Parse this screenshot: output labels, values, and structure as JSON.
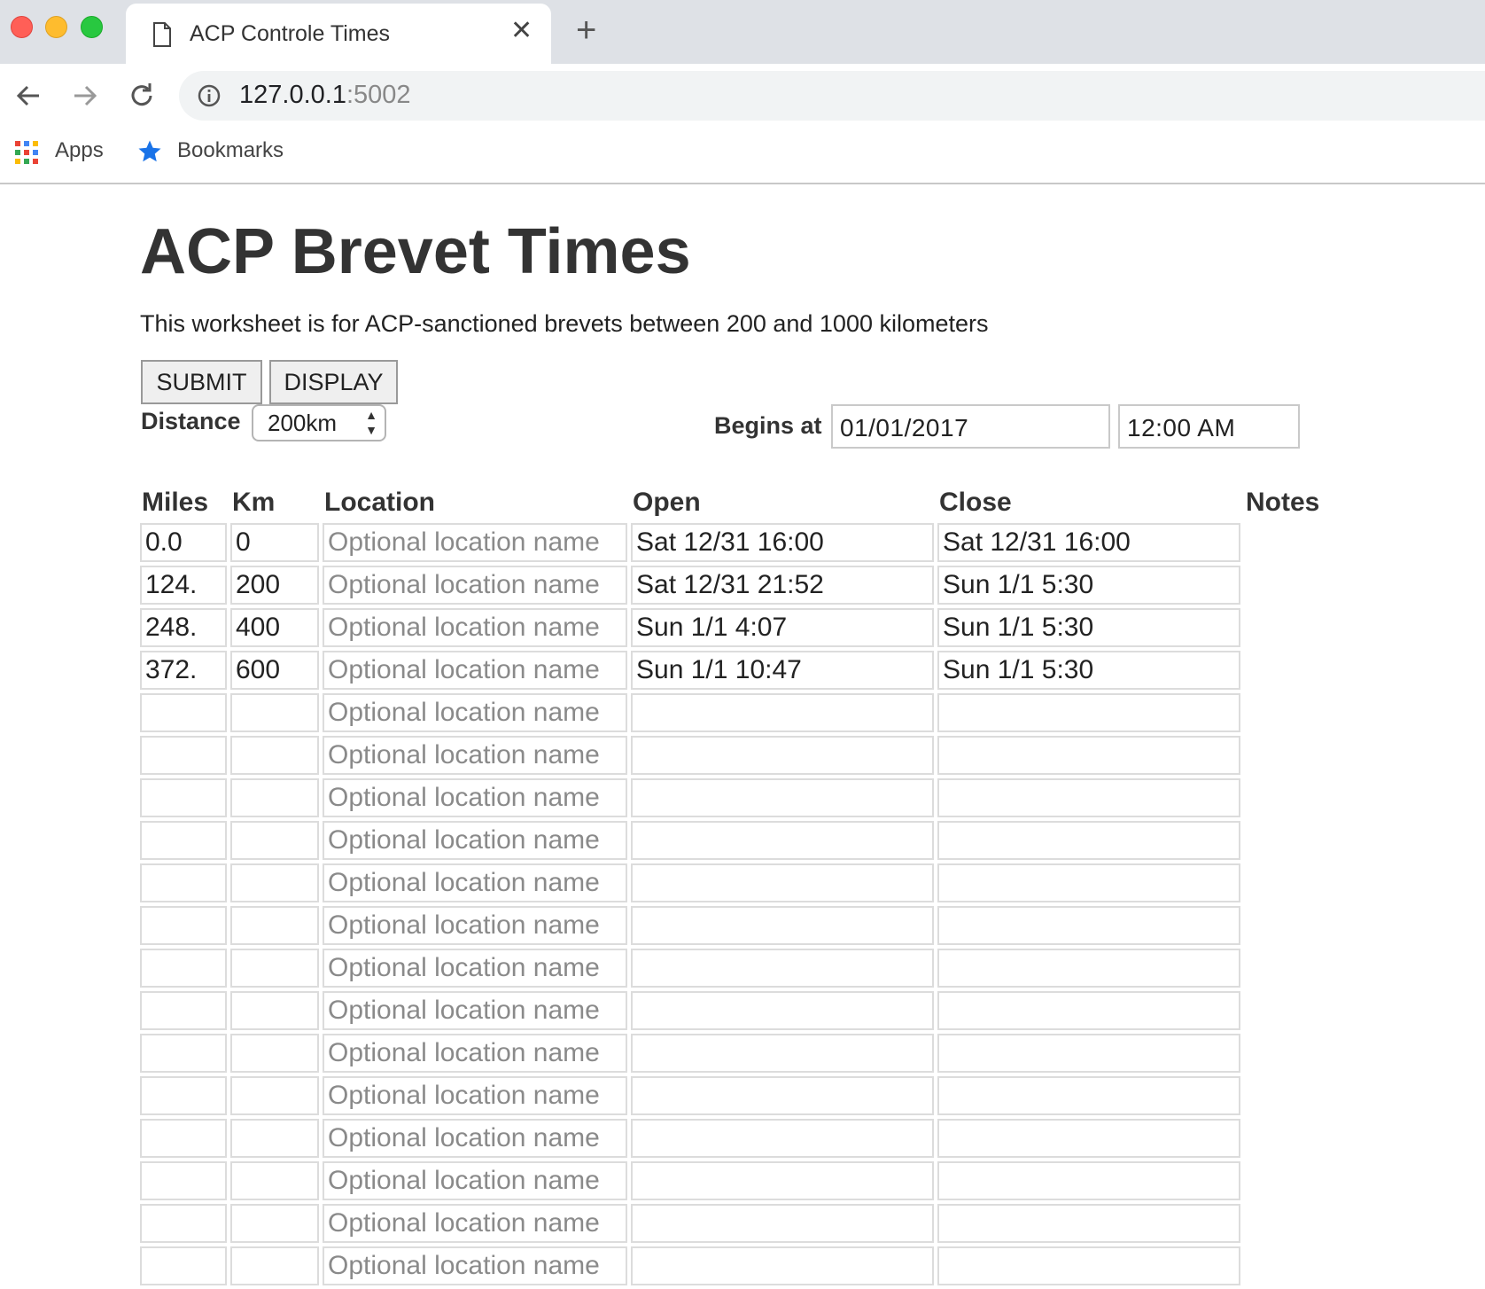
{
  "browser": {
    "tab_title": "ACP Controle Times",
    "url_host": "127.0.0.1",
    "url_port": ":5002",
    "bookmarks": [
      {
        "label": "Apps",
        "icon": "apps-grid-icon"
      },
      {
        "label": "Bookmarks",
        "icon": "star-icon"
      }
    ]
  },
  "page": {
    "title": "ACP Brevet Times",
    "description": "This worksheet is for ACP-sanctioned brevets between 200 and 1000 kilometers",
    "submit_label": "SUBMIT",
    "display_label": "DISPLAY",
    "distance_label": "Distance",
    "distance_value": "200km",
    "begins_label": "Begins at",
    "begin_date": "01/01/2017",
    "begin_time": "12:00 AM"
  },
  "table": {
    "headers": {
      "miles": "Miles",
      "km": "Km",
      "location": "Location",
      "open": "Open",
      "close": "Close",
      "notes": "Notes"
    },
    "location_placeholder": "Optional location name",
    "rows": [
      {
        "miles": "0.0",
        "km": "0",
        "open": "Sat 12/31 16:00",
        "close": "Sat 12/31 16:00"
      },
      {
        "miles": "124.",
        "km": "200",
        "open": "Sat 12/31 21:52",
        "close": "Sun 1/1 5:30"
      },
      {
        "miles": "248.",
        "km": "400",
        "open": "Sun 1/1 4:07",
        "close": "Sun 1/1 5:30"
      },
      {
        "miles": "372.",
        "km": "600",
        "open": "Sun 1/1 10:47",
        "close": "Sun 1/1 5:30"
      },
      {
        "miles": "",
        "km": "",
        "open": "",
        "close": ""
      },
      {
        "miles": "",
        "km": "",
        "open": "",
        "close": ""
      },
      {
        "miles": "",
        "km": "",
        "open": "",
        "close": ""
      },
      {
        "miles": "",
        "km": "",
        "open": "",
        "close": ""
      },
      {
        "miles": "",
        "km": "",
        "open": "",
        "close": ""
      },
      {
        "miles": "",
        "km": "",
        "open": "",
        "close": ""
      },
      {
        "miles": "",
        "km": "",
        "open": "",
        "close": ""
      },
      {
        "miles": "",
        "km": "",
        "open": "",
        "close": ""
      },
      {
        "miles": "",
        "km": "",
        "open": "",
        "close": ""
      },
      {
        "miles": "",
        "km": "",
        "open": "",
        "close": ""
      },
      {
        "miles": "",
        "km": "",
        "open": "",
        "close": ""
      },
      {
        "miles": "",
        "km": "",
        "open": "",
        "close": ""
      },
      {
        "miles": "",
        "km": "",
        "open": "",
        "close": ""
      },
      {
        "miles": "",
        "km": "",
        "open": "",
        "close": ""
      }
    ]
  },
  "colors": {
    "close_dot": "#ff5f57",
    "minimize_dot": "#febc2e",
    "maximize_dot": "#28c840",
    "star": "#1a73e8"
  }
}
